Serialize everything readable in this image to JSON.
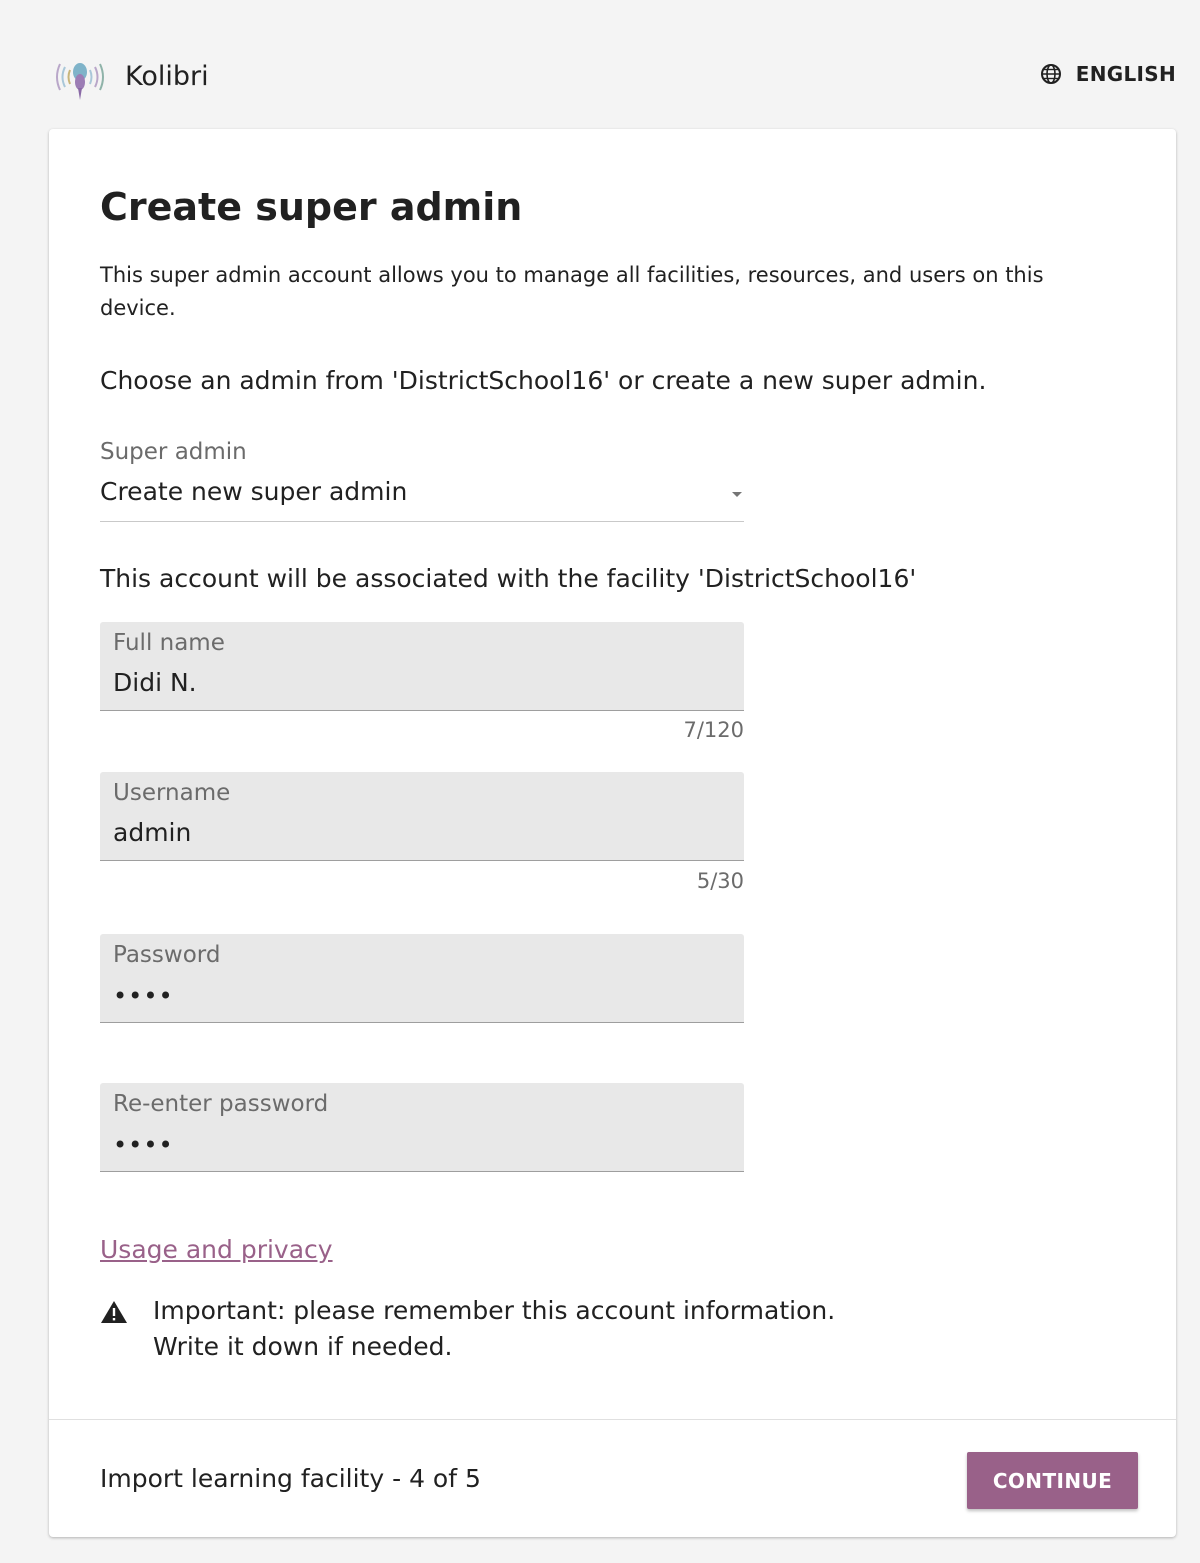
{
  "header": {
    "app_name": "Kolibri",
    "language_label": "ENGLISH"
  },
  "page": {
    "title": "Create super admin",
    "description": "This super admin account allows you to manage all facilities, resources, and users on this device.",
    "choose_text": "Choose an admin from 'DistrictSchool16' or create a new super admin.",
    "super_admin_select": {
      "label": "Super admin",
      "value": "Create new super admin"
    },
    "association_text": "This account will be associated with the facility 'DistrictSchool16'",
    "full_name": {
      "label": "Full name",
      "value": "Didi N.",
      "counter": "7/120"
    },
    "username": {
      "label": "Username",
      "value": "admin",
      "counter": "5/30"
    },
    "password": {
      "label": "Password",
      "value": "••••"
    },
    "reenter_password": {
      "label": "Re-enter password",
      "value": "••••"
    },
    "privacy_link": "Usage and privacy",
    "warning": {
      "line1": "Important: please remember this account information.",
      "line2": "Write it down if needed."
    }
  },
  "footer": {
    "progress": "Import learning facility - 4 of 5",
    "continue_label": "CONTINUE"
  },
  "colors": {
    "accent": "#996189",
    "background": "#f4f4f4",
    "field_background": "#e8e8e8"
  }
}
